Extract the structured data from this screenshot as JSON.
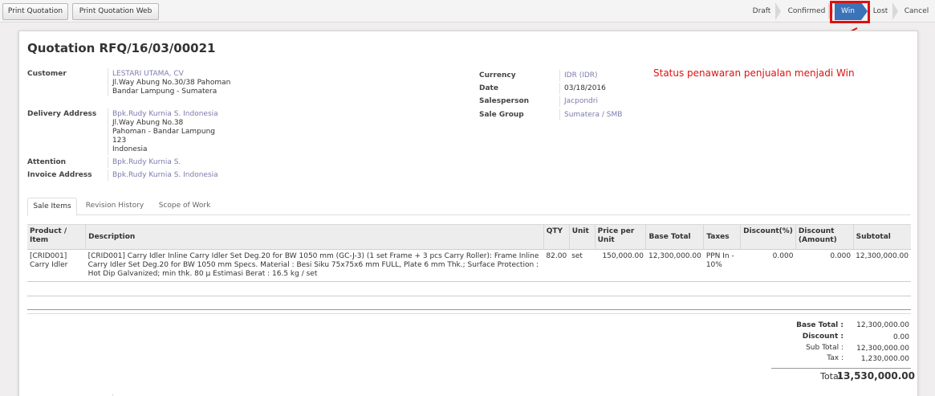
{
  "toolbar": {
    "buttons": [
      "Print Quotation",
      "Print Quotation Web"
    ],
    "statuses": [
      "Draft",
      "Confirmed",
      "Win",
      "Lost",
      "Cancel"
    ],
    "active_status": "Win"
  },
  "annotation": "Status penawaran penjualan menjadi Win",
  "form": {
    "title": "Quotation RFQ/16/03/00021",
    "customer": {
      "label": "Customer",
      "name": "LESTARI UTAMA, CV",
      "address": [
        "Jl.Way Abung No.30/38 Pahoman",
        "Bandar Lampung - Sumatera"
      ]
    },
    "delivery": {
      "label": "Delivery Address",
      "name": "Bpk.Rudy Kurnia S. Indonesia",
      "address": [
        "Jl.Way Abung No.38",
        "Pahoman - Bandar Lampung",
        "123",
        "Indonesia"
      ]
    },
    "attention": {
      "label": "Attention",
      "value": "Bpk.Rudy Kurnia S."
    },
    "invoice": {
      "label": "Invoice Address",
      "value": "Bpk.Rudy Kurnia S. Indonesia"
    },
    "currency": {
      "label": "Currency",
      "value": "IDR (IDR)"
    },
    "date": {
      "label": "Date",
      "value": "03/18/2016"
    },
    "salesperson": {
      "label": "Salesperson",
      "value": "Jacpondri"
    },
    "sale_group": {
      "label": "Sale Group",
      "value": "Sumatera / SMB"
    }
  },
  "tabs": [
    "Sale Items",
    "Revision History",
    "Scope of Work"
  ],
  "table": {
    "headers": [
      "Product / Item",
      "Description",
      "QTY",
      "Unit",
      "Price per Unit",
      "Base Total",
      "Taxes",
      "Discount(%)",
      "Discount (Amount)",
      "Subtotal"
    ],
    "rows": [
      {
        "product": "[CRID001] Carry Idler",
        "description": "[CRID001] Carry Idler Inline Carry Idler Set Deg.20 for BW 1050 mm (GC-J-3) (1 set Frame + 3 pcs Carry Roller): Frame Inline Carry Idler Set Deg.20 for BW 1050 mm Specs. Material : Besi Siku 75x75x6 mm FULL, Plate 6 mm Thk.; Surface Protection : Hot Dip Galvanized; min thk. 80 μ Estimasi Berat : 16.5 kg / set",
        "qty": "82.00",
        "unit": "set",
        "price": "150,000.00",
        "base_total": "12,300,000.00",
        "taxes": "PPN In - 10%",
        "discount_pct": "0.000",
        "discount_amt": "0.000",
        "subtotal": "12,300,000.00"
      }
    ]
  },
  "totals": {
    "base_total_label": "Base Total :",
    "base_total": "12,300,000.00",
    "discount_label": "Discount :",
    "discount": "0.00",
    "sub_total_label": "Sub Total :",
    "sub_total": "12,300,000.00",
    "tax_label": "Tax :",
    "tax": "1,230,000.00",
    "total_label": "Total :",
    "total": "13,530,000.00"
  },
  "colors": {
    "accent": "#3a73b8",
    "highlight": "#e01010",
    "link": "#7c7bad"
  }
}
